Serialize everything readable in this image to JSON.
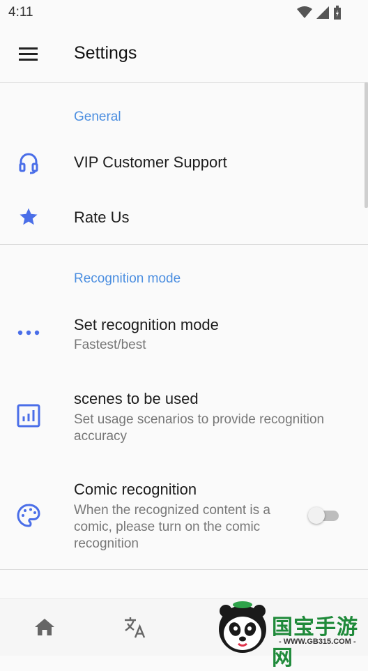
{
  "status_bar": {
    "time": "4:11"
  },
  "app_bar": {
    "title": "Settings"
  },
  "sections": {
    "general": {
      "title": "General",
      "vip_support": {
        "title": "VIP Customer Support",
        "icon": "headset-icon"
      },
      "rate_us": {
        "title": "Rate Us",
        "icon": "star-icon"
      }
    },
    "recognition": {
      "title": "Recognition mode",
      "set_mode": {
        "title": "Set recognition mode",
        "subtitle": "Fastest/best",
        "icon": "more-horizontal-icon"
      },
      "scenes": {
        "title": "scenes to be used",
        "subtitle": "Set usage scenarios to provide recognition accuracy",
        "icon": "chart-icon"
      },
      "comic": {
        "title": "Comic recognition",
        "subtitle": "When the recognized content is a comic, please turn on the comic recognition",
        "icon": "palette-icon",
        "enabled": false
      }
    }
  },
  "bottom_nav": {
    "items": [
      {
        "icon": "home-icon"
      },
      {
        "icon": "translate-icon"
      }
    ]
  },
  "watermark": {
    "text": "国宝手游网",
    "url": "- WWW.GB315.COM -"
  },
  "colors": {
    "accent": "#4b8ee0",
    "icon": "#4a6ee8"
  }
}
